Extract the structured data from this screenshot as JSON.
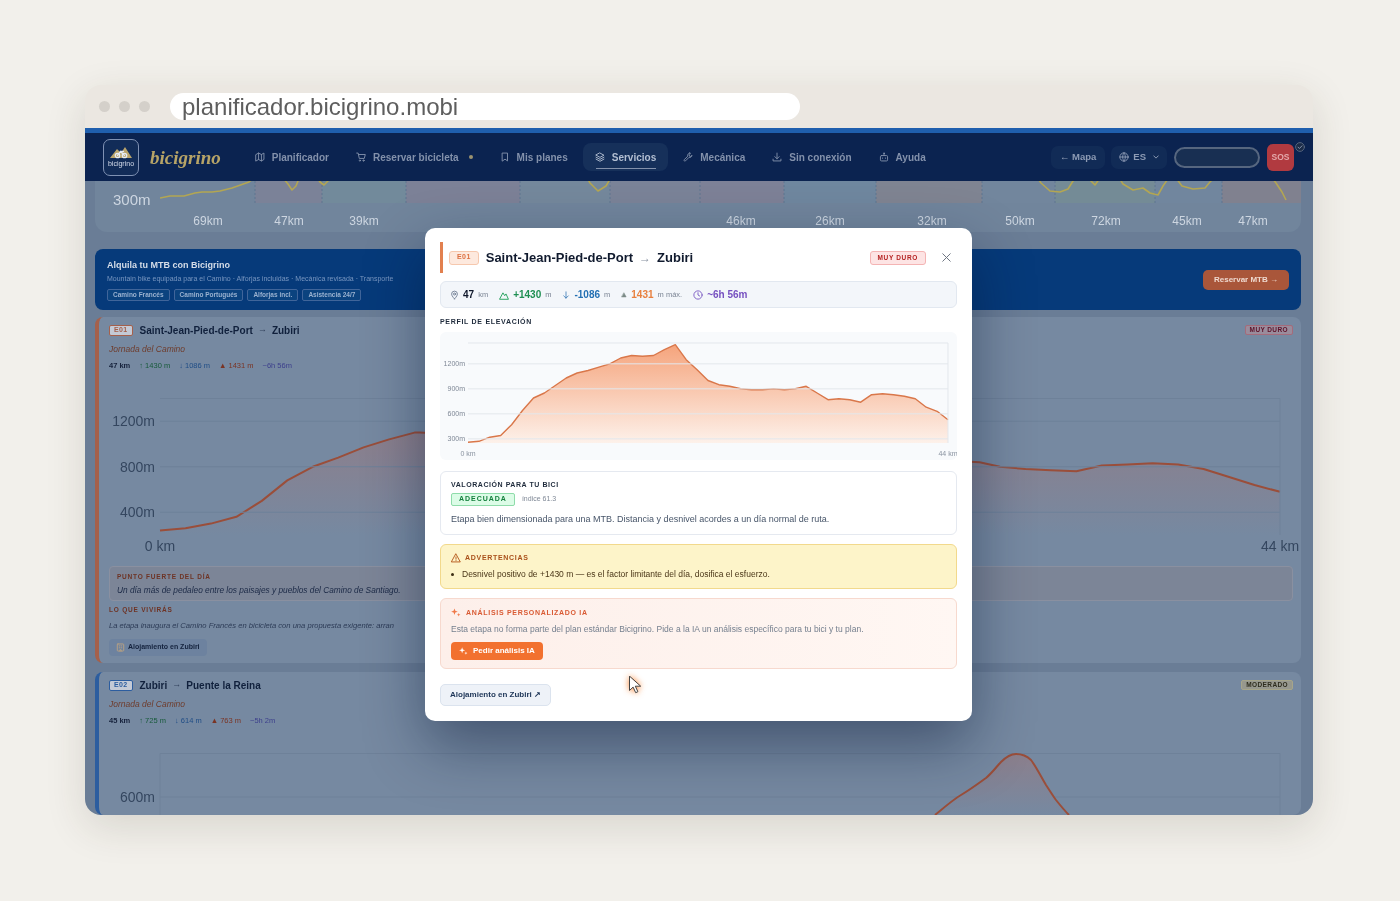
{
  "browser": {
    "url": "planificador.bicigrino.mobi"
  },
  "navbar": {
    "logo_caption": "bicigrino",
    "brand": "bicigrino",
    "items": [
      {
        "label": "Planificador",
        "selected": false,
        "dot": false
      },
      {
        "label": "Reservar bicicleta",
        "selected": false,
        "dot": true
      },
      {
        "label": "Mis planes",
        "selected": false,
        "dot": false
      },
      {
        "label": "Servicios",
        "selected": true,
        "dot": false
      },
      {
        "label": "Mecánica",
        "selected": false,
        "dot": false
      },
      {
        "label": "Sin conexión",
        "selected": false,
        "dot": false
      },
      {
        "label": "Ayuda",
        "selected": false,
        "dot": false
      }
    ],
    "map_button": "← Mapa",
    "language": "ES",
    "sos_button": "SOS"
  },
  "overview": {
    "axis_label": "300m",
    "segment_labels": [
      "69km",
      "47km",
      "39km",
      "46km",
      "26km",
      "32km",
      "50km",
      "72km",
      "45km",
      "47km"
    ]
  },
  "rental_banner": {
    "title": "Alquila tu MTB con Bicigrino",
    "subtitle": "Mountain bike equipada para el Camino · Alforjas incluidas · Mecánica revisada · Transporte",
    "tags": [
      "Camino Francés",
      "Camino Portugués",
      "Alforjas incl.",
      "Asistencia 24/7"
    ],
    "button": "Reservar MTB →"
  },
  "stages": [
    {
      "code": "E01",
      "from": "Saint-Jean-Pied-de-Port",
      "arrow": "→",
      "to": "Zubiri",
      "color": "#a5604b",
      "difficulty": {
        "label": "MUY DURO",
        "kind": "hard"
      },
      "subtitle": "Jornada del Camino",
      "stats": [
        {
          "kind": "distance",
          "text": "47 km"
        },
        {
          "kind": "ascent",
          "text": "↑ 1430 m"
        },
        {
          "kind": "descent",
          "text": "↓ 1086 m"
        },
        {
          "kind": "max",
          "text": "▲ 1431 m"
        },
        {
          "kind": "time",
          "text": "~6h 56m"
        }
      ],
      "chart_data": {
        "type": "area",
        "grid": true,
        "x": [
          0,
          1,
          2,
          3,
          4,
          5,
          6,
          7,
          8,
          9,
          10,
          10.2,
          32.2,
          33,
          34,
          35,
          36,
          37,
          38,
          39,
          40,
          41,
          42,
          43,
          44
        ],
        "series": [
          {
            "color": "#9a4e3a",
            "values": [
              240,
              260,
              300,
              360,
              500,
              680,
              800,
              880,
              970,
              1040,
              1100,
              1100,
              840,
              800,
              780,
              770,
              760,
              810,
              820,
              830,
              820,
              780,
              710,
              640,
              580
            ]
          }
        ],
        "xlim": [
          0,
          44
        ],
        "ylim": [
          200,
          1400
        ],
        "xticks": [
          {
            "value": 0,
            "label": "0 km"
          },
          {
            "value": 44,
            "label": "44 km"
          }
        ],
        "yticks": [
          {
            "value": 400,
            "label": "400m"
          },
          {
            "value": 800,
            "label": "800m"
          },
          {
            "value": 1200,
            "label": "1200m"
          }
        ]
      },
      "highlight": {
        "title": "PUNTO FUERTE DEL DÍA",
        "text": "Un día más de pedaleo entre los paisajes y pueblos del Camino de Santiago."
      },
      "experience": {
        "title": "LO QUE VIVIRÁS",
        "text": "La etapa inaugura el Camino Francés en bicicleta con una propuesta exigente: arran"
      },
      "lodging_button": "Alojamiento en Zubiri"
    },
    {
      "code": "E02",
      "from": "Zubiri",
      "arrow": "→",
      "to": "Puente la Reina",
      "color": "#2c5d9f",
      "difficulty": {
        "label": "MODERADO",
        "kind": "moderate"
      },
      "subtitle": "Jornada del Camino",
      "stats": [
        {
          "kind": "distance",
          "text": "45 km"
        },
        {
          "kind": "ascent",
          "text": "↑ 725 m"
        },
        {
          "kind": "descent",
          "text": "↓ 614 m"
        },
        {
          "kind": "max",
          "text": "▲ 763 m"
        },
        {
          "kind": "time",
          "text": "~5h 2m"
        }
      ],
      "profile": {
        "y_labels": [
          "600m"
        ]
      }
    }
  ],
  "modal": {
    "code": "E01",
    "from": "Saint-Jean-Pied-de-Port",
    "arrow": "→",
    "to": "Zubiri",
    "difficulty": {
      "label": "MUY DURO",
      "kind": "hard"
    },
    "stats": [
      {
        "kind": "distance",
        "value": "47",
        "unit": "km"
      },
      {
        "kind": "ascent",
        "value": "+1430",
        "unit": "m"
      },
      {
        "kind": "descent",
        "value": "-1086",
        "unit": "m"
      },
      {
        "kind": "max",
        "value": "1431",
        "unit": "m máx."
      },
      {
        "kind": "time",
        "value": "~6h 56m"
      }
    ],
    "profile_title": "PERFIL DE ELEVACIÓN",
    "chart_data": {
      "type": "area",
      "grid": true,
      "x": [
        0,
        1,
        2,
        3,
        4,
        5,
        6,
        7,
        8,
        9,
        10,
        11,
        12,
        13,
        14,
        15,
        16,
        17,
        18,
        19,
        20,
        21,
        22,
        23,
        24,
        25,
        26,
        27,
        28,
        29,
        30,
        31,
        32,
        33,
        34,
        35,
        36,
        37,
        38,
        39,
        40,
        41,
        42,
        43,
        44
      ],
      "series": [
        {
          "color": "#d9774a",
          "values": [
            260,
            270,
            320,
            340,
            470,
            640,
            790,
            850,
            940,
            1030,
            1090,
            1120,
            1160,
            1200,
            1270,
            1300,
            1290,
            1300,
            1370,
            1430,
            1250,
            1130,
            1000,
            950,
            930,
            900,
            890,
            890,
            900,
            890,
            900,
            930,
            850,
            770,
            780,
            770,
            740,
            830,
            840,
            830,
            810,
            780,
            680,
            630,
            530
          ]
        }
      ],
      "xlim": [
        0,
        44
      ],
      "ylim": [
        250,
        1450
      ],
      "xticks": [
        {
          "value": 0,
          "label": "0 km"
        },
        {
          "value": 44,
          "label": "44 km"
        }
      ],
      "yticks": [
        {
          "value": 300,
          "label": "300m"
        },
        {
          "value": 600,
          "label": "600m"
        },
        {
          "value": 900,
          "label": "900m"
        },
        {
          "value": 1200,
          "label": "1200m"
        }
      ]
    },
    "rating": {
      "title": "VALORACIÓN PARA TU BICI",
      "badge": "ADECUADA",
      "index": "índice 61.3",
      "text": "Etapa bien dimensionada para una MTB. Distancia y desnivel acordes a un día normal de ruta."
    },
    "warnings": {
      "title": "ADVERTENCIAS",
      "items": [
        "Desnivel positivo de +1430 m — es el factor limitante del día, dosifica el esfuerzo."
      ]
    },
    "ai_analysis": {
      "title": "ANÁLISIS PERSONALIZADO IA",
      "text": "Esta etapa no forma parte del plan estándar Bicigrino. Pide a la IA un análisis específico para tu bici y tu plan.",
      "button": "Pedir análisis IA"
    },
    "lodging_button": "Alojamiento en Zubiri ↗"
  }
}
